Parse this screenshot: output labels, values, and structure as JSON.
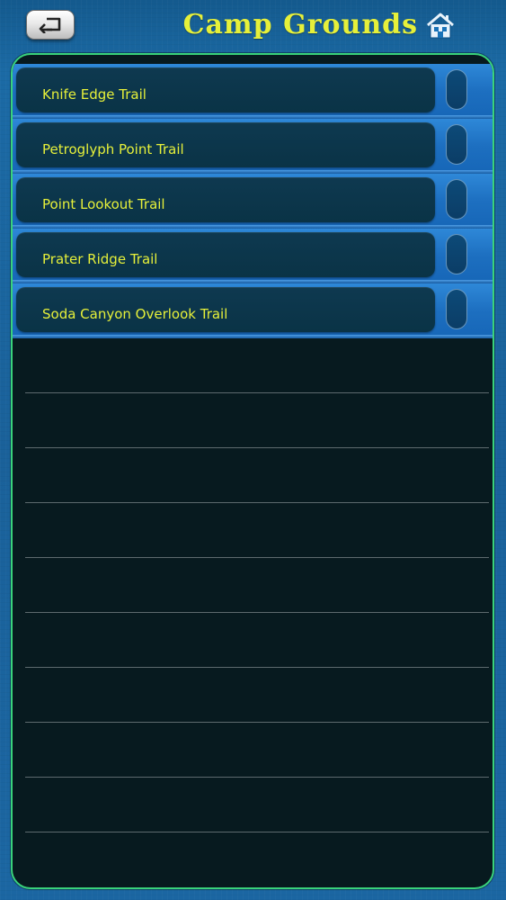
{
  "header": {
    "title": "Camp Grounds",
    "back_icon": "back-arrow-icon",
    "home_icon": "home-icon"
  },
  "list": {
    "items": [
      {
        "label": "Knife Edge Trail"
      },
      {
        "label": "Petroglyph Point Trail"
      },
      {
        "label": "Point Lookout Trail"
      },
      {
        "label": "Prater Ridge Trail"
      },
      {
        "label": "Soda Canyon Overlook Trail"
      }
    ]
  },
  "colors": {
    "accent_text": "#e6f03a",
    "panel_border": "#39d27b",
    "row_blue": "#1d6fc0",
    "background": "#1a619a"
  }
}
